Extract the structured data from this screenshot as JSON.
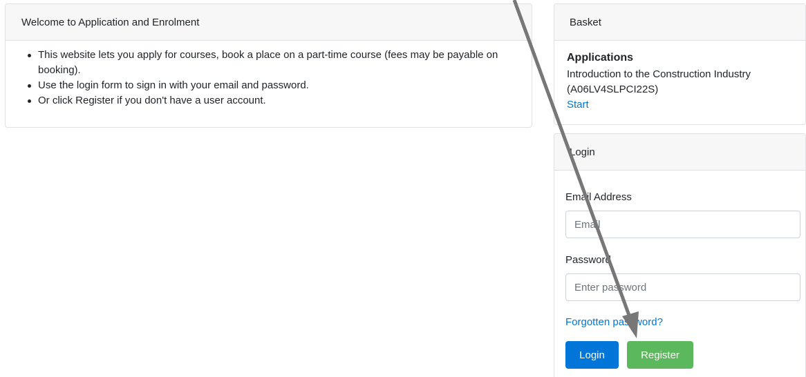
{
  "welcome": {
    "title": "Welcome to Application and Enrolment",
    "bullets": [
      "This website lets you apply for courses, book a place on a part-time course (fees may be payable on booking).",
      "Use the login form to sign in with your email and password.",
      "Or click Register if you don't have a user account."
    ]
  },
  "basket": {
    "title": "Basket",
    "applications_heading": "Applications",
    "course": "Introduction to the Construction Industry (A06LV4SLPCI22S)",
    "start_label": "Start"
  },
  "login": {
    "title": "Login",
    "email_label": "Email Address",
    "email_placeholder": "Email",
    "email_value": "",
    "password_label": "Password",
    "password_placeholder": "Enter password",
    "password_value": "",
    "forgot_label": "Forgotten password?",
    "login_button": "Login",
    "register_button": "Register"
  },
  "annotation": {
    "arrow_color": "#777777",
    "arrow_target": "register-button"
  }
}
